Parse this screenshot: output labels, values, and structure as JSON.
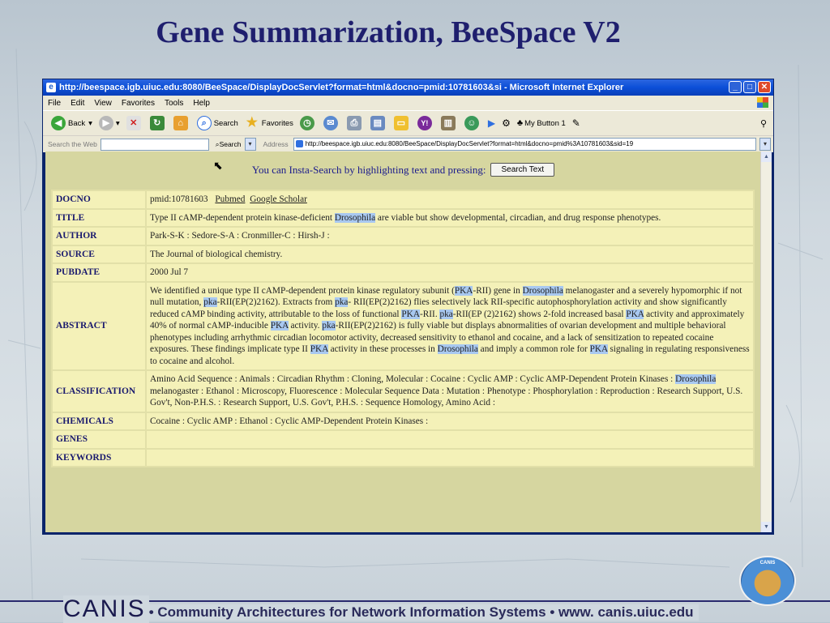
{
  "slide": {
    "title": "Gene Summarization, BeeSpace V2",
    "footer_canis": "CANIS",
    "footer_tagline": "• Community Architectures for Network Information Systems •  www. canis.uiuc.edu",
    "logo_text": "CANIS"
  },
  "browser": {
    "window_title": "http://beespace.igb.uiuc.edu:8080/BeeSpace/DisplayDocServlet?format=html&docno=pmid:10781603&si - Microsoft Internet Explorer",
    "menu": [
      "File",
      "Edit",
      "View",
      "Favorites",
      "Tools",
      "Help"
    ],
    "toolbar": {
      "back": "Back",
      "search": "Search",
      "favorites": "Favorites",
      "my_button": "My Button 1"
    },
    "search_the_web_label": "Search the Web",
    "search_button": "Search",
    "address_label": "Address",
    "address_value": "http://beespace.igb.uiuc.edu:8080/BeeSpace/DisplayDocServlet?format=html&docno=pmid%3A10781603&sid=19"
  },
  "page": {
    "insta_text": "You can Insta-Search by highlighting text and pressing:",
    "search_text_button": "Search Text",
    "rows": {
      "docno_label": "DOCNO",
      "docno_value": "pmid:10781603",
      "docno_link_pubmed": "Pubmed",
      "docno_link_scholar": "Google Scholar",
      "title_label": "TITLE",
      "title_pre": "Type II cAMP-dependent protein kinase-deficient ",
      "title_hl": "Drosophila",
      "title_post": " are viable but show developmental, circadian, and drug response phenotypes.",
      "author_label": "AUTHOR",
      "author_value": "Park-S-K : Sedore-S-A : Cronmiller-C : Hirsh-J :",
      "source_label": "SOURCE",
      "source_value": "The Journal of biological chemistry.",
      "pubdate_label": "PUBDATE",
      "pubdate_value": "2000 Jul 7",
      "abstract_label": "ABSTRACT",
      "abstract_parts": [
        {
          "t": "We identified a unique type II cAMP-dependent protein kinase regulatory subunit (",
          "h": false
        },
        {
          "t": "PKA",
          "h": true
        },
        {
          "t": "-RII) gene in ",
          "h": false
        },
        {
          "t": "Drosophila",
          "h": true
        },
        {
          "t": " melanogaster and a severely hypomorphic if not null mutation, ",
          "h": false
        },
        {
          "t": "pka",
          "h": true
        },
        {
          "t": "-RII(EP(2)2162). Extracts from ",
          "h": false
        },
        {
          "t": "pka",
          "h": true
        },
        {
          "t": "- RII(EP(2)2162) flies selectively lack RII-specific autophosphorylation activity and show significantly reduced cAMP binding activity, attributable to the loss of functional ",
          "h": false
        },
        {
          "t": "PKA",
          "h": true
        },
        {
          "t": "-RII. ",
          "h": false
        },
        {
          "t": "pka",
          "h": true
        },
        {
          "t": "-RII(EP (2)2162) shows 2-fold increased basal ",
          "h": false
        },
        {
          "t": "PKA",
          "h": true
        },
        {
          "t": " activity and approximately 40% of normal cAMP-inducible ",
          "h": false
        },
        {
          "t": "PKA",
          "h": true
        },
        {
          "t": " activity. ",
          "h": false
        },
        {
          "t": "pka",
          "h": true
        },
        {
          "t": "-RII(EP(2)2162) is fully viable but displays abnormalities of ovarian development and multiple behavioral phenotypes including arrhythmic circadian locomotor activity, decreased sensitivity to ethanol and cocaine, and a lack of sensitization to repeated cocaine exposures. These findings implicate type II ",
          "h": false
        },
        {
          "t": "PKA",
          "h": true
        },
        {
          "t": " activity in these processes in ",
          "h": false
        },
        {
          "t": "Drosophila",
          "h": true
        },
        {
          "t": " and imply a common role for ",
          "h": false
        },
        {
          "t": "PKA",
          "h": true
        },
        {
          "t": " signaling in regulating responsiveness to cocaine and alcohol.",
          "h": false
        }
      ],
      "classification_label": "CLASSIFICATION",
      "classification_pre": "Amino Acid Sequence : Animals : Circadian Rhythm : Cloning, Molecular : Cocaine : Cyclic AMP : Cyclic AMP-Dependent Protein Kinases : ",
      "classification_hl": "Drosophila",
      "classification_post": " melanogaster : Ethanol : Microscopy, Fluorescence : Molecular Sequence Data : Mutation : Phenotype : Phosphorylation : Reproduction : Research Support, U.S. Gov't, Non-P.H.S. : Research Support, U.S. Gov't, P.H.S. : Sequence Homology, Amino Acid :",
      "chemicals_label": "CHEMICALS",
      "chemicals_value": "Cocaine : Cyclic AMP : Ethanol : Cyclic AMP-Dependent Protein Kinases :",
      "genes_label": "GENES",
      "genes_value": "",
      "keywords_label": "KEYWORDS",
      "keywords_value": ""
    }
  },
  "colors": {
    "highlight": "#a8c8f0",
    "page_bg": "#d6d6a0",
    "table_bg": "#f4f1b8",
    "label_color": "#1a1a6e",
    "rule_green": "#2a8a2a"
  }
}
